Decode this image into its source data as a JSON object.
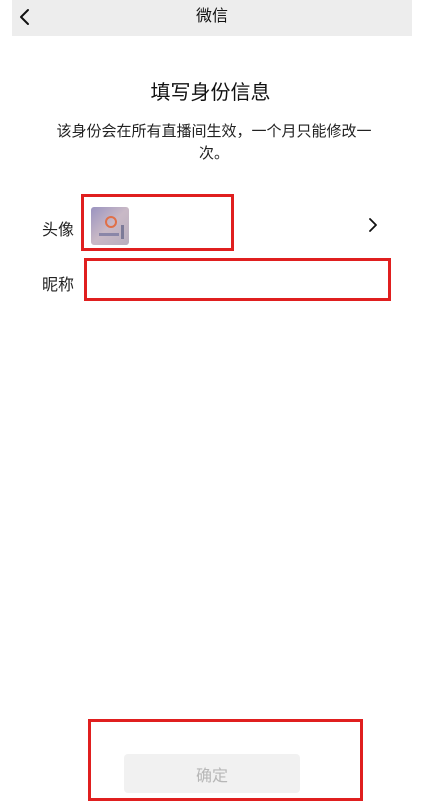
{
  "header": {
    "title": "微信",
    "back_icon": "chevron-left-icon"
  },
  "page": {
    "heading": "填写身份信息",
    "description": "该身份会在所有直播间生效，一个月只能修改一次。"
  },
  "form": {
    "avatar_label": "头像",
    "avatar_image": "avatar-photo",
    "avatar_arrow_icon": "chevron-right-icon",
    "nickname_label": "昵称",
    "nickname_value": "",
    "nickname_placeholder": ""
  },
  "footer": {
    "confirm_label": "确定"
  },
  "colors": {
    "navbar_bg": "#ededed",
    "annotation_red": "#e01f1f",
    "button_disabled_bg": "#f1f1f1",
    "button_disabled_text": "#b7b7b7"
  }
}
